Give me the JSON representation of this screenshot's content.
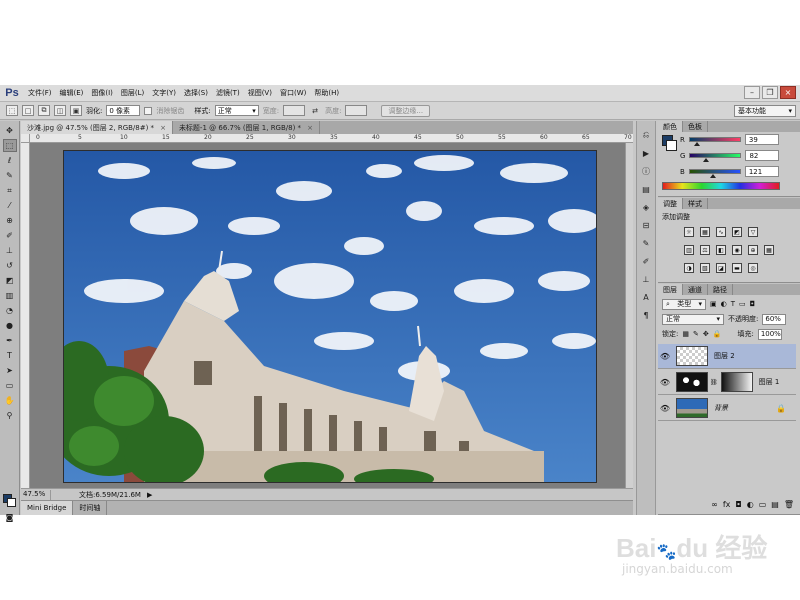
{
  "menubar": {
    "logo": "Ps",
    "items": [
      "文件(F)",
      "编辑(E)",
      "图像(I)",
      "图层(L)",
      "文字(Y)",
      "选择(S)",
      "滤镜(T)",
      "视图(V)",
      "窗口(W)",
      "帮助(H)"
    ],
    "window_controls": [
      "–",
      "❐",
      "×"
    ]
  },
  "options": {
    "feather_label": "羽化:",
    "feather_value": "0 像素",
    "antialias_label": "消除锯齿",
    "style_label": "样式:",
    "style_value": "正常",
    "width_label": "宽度:",
    "height_label": "高度:",
    "refine_edge": "调整边缘...",
    "workspace": "基本功能"
  },
  "tabs": [
    {
      "label": "沙滩.jpg @ 47.5% (图层 2, RGB/8#) *",
      "close": "×"
    },
    {
      "label": "未标题-1 @ 66.7% (图层 1, RGB/8) *",
      "close": "×"
    }
  ],
  "ruler_ticks": [
    "0",
    "5",
    "10",
    "15",
    "20",
    "25",
    "30",
    "35",
    "40",
    "45",
    "50",
    "55",
    "60",
    "65",
    "70"
  ],
  "status": {
    "zoom": "47.5%",
    "doc_size": "文档:6.59M/21.6M"
  },
  "bottom_tabs": [
    "Mini Bridge",
    "时间轴"
  ],
  "color_panel": {
    "tabs": [
      "颜色",
      "色板"
    ],
    "r_label": "R",
    "r_value": "39",
    "g_label": "G",
    "g_value": "82",
    "b_label": "B",
    "b_value": "121",
    "r_fraction": 0.15,
    "g_fraction": 0.32,
    "b_fraction": 0.47,
    "foreground_color": "#1c3d66"
  },
  "adjust_panel": {
    "tabs": [
      "调整",
      "样式"
    ],
    "title": "添加调整"
  },
  "layers_panel": {
    "tabs": [
      "图层",
      "通道",
      "路径"
    ],
    "filter_kind": "类型",
    "blend_mode": "正常",
    "opacity_label": "不透明度:",
    "opacity_value": "60%",
    "lock_label": "锁定:",
    "fill_label": "填充:",
    "fill_value": "100%",
    "layers": [
      {
        "name": "图层 2",
        "selected": true
      },
      {
        "name": "图层 1",
        "selected": false
      },
      {
        "name": "背景",
        "selected": false
      }
    ],
    "footer_icons": [
      "∞",
      "fx",
      "◘",
      "◐",
      "▭",
      "▤",
      "🗑"
    ]
  },
  "watermark": {
    "url": "jingyan.baidu.com"
  },
  "colors": {
    "sky": "#2e6ab7",
    "accent_blue": "#1c3d66"
  }
}
